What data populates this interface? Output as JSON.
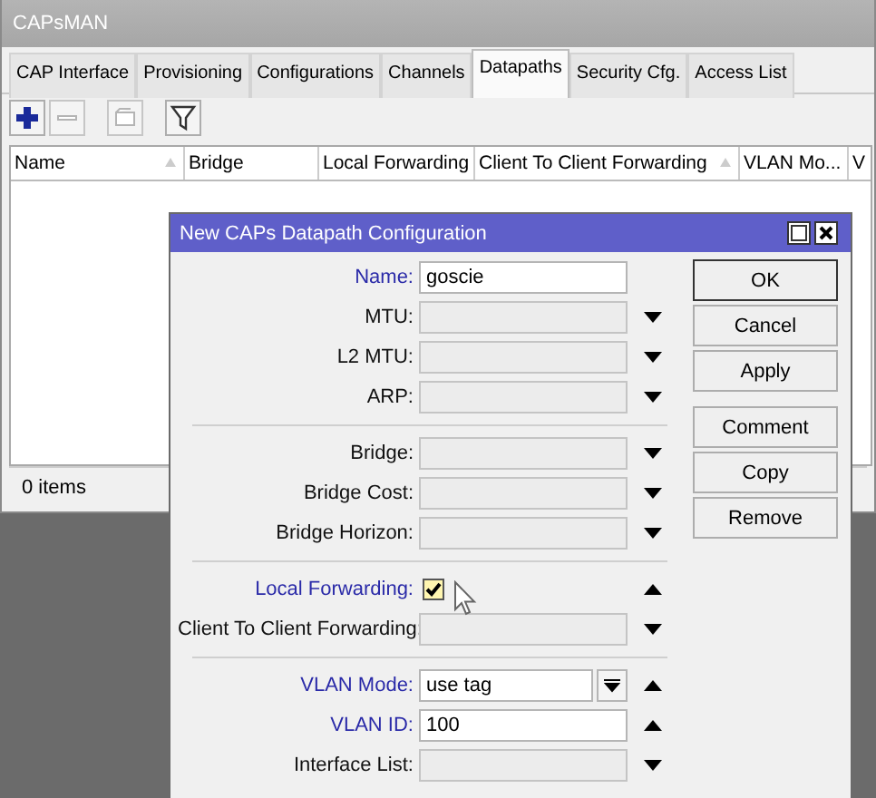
{
  "window": {
    "title": "CAPsMAN"
  },
  "tabs": [
    {
      "label": "CAP Interface",
      "selected": false
    },
    {
      "label": "Provisioning",
      "selected": false
    },
    {
      "label": "Configurations",
      "selected": false
    },
    {
      "label": "Channels",
      "selected": false
    },
    {
      "label": "Datapaths",
      "selected": true
    },
    {
      "label": "Security Cfg.",
      "selected": false
    },
    {
      "label": "Access List",
      "selected": false
    }
  ],
  "toolbar": [
    {
      "kind": "add",
      "disabled": false
    },
    {
      "kind": "remove",
      "disabled": true
    },
    {
      "kind": "comment",
      "disabled": true
    },
    {
      "kind": "filter",
      "disabled": false
    }
  ],
  "table": {
    "columns": [
      {
        "label": "Name",
        "sorted": true
      },
      {
        "label": "Bridge",
        "sorted": false
      },
      {
        "label": "Local Forwarding",
        "sorted": false
      },
      {
        "label": "Client To Client Forwarding",
        "sorted": true
      },
      {
        "label": "VLAN Mo...",
        "sorted": false
      },
      {
        "label": "V",
        "sorted": false
      }
    ]
  },
  "status_bar": "0 items",
  "dialog": {
    "title": "New CAPs Datapath Configuration",
    "groups": [
      [
        {
          "kind": "text",
          "label": "Name:",
          "highlighted": true,
          "value": "goscie"
        },
        {
          "kind": "combo",
          "label": "MTU:",
          "highlighted": false,
          "expanded": false
        },
        {
          "kind": "combo",
          "label": "L2 MTU:",
          "highlighted": false,
          "expanded": false
        },
        {
          "kind": "combo",
          "label": "ARP:",
          "highlighted": false,
          "expanded": false
        }
      ],
      [
        {
          "kind": "combo",
          "label": "Bridge:",
          "highlighted": false,
          "expanded": false
        },
        {
          "kind": "combo",
          "label": "Bridge Cost:",
          "highlighted": false,
          "expanded": false
        },
        {
          "kind": "combo",
          "label": "Bridge Horizon:",
          "highlighted": false,
          "expanded": false
        }
      ],
      [
        {
          "kind": "checkbox",
          "label": "Local Forwarding:",
          "highlighted": true,
          "checked": true,
          "expanded": true
        },
        {
          "kind": "combo",
          "label": "Client To Client Forwarding:",
          "highlighted": false,
          "expanded": false
        }
      ],
      [
        {
          "kind": "select",
          "label": "VLAN Mode:",
          "highlighted": true,
          "value": "use tag",
          "expanded": true
        },
        {
          "kind": "text",
          "label": "VLAN ID:",
          "highlighted": true,
          "value": "100",
          "expanded": true
        },
        {
          "kind": "combo",
          "label": "Interface List:",
          "highlighted": false,
          "expanded": false
        }
      ]
    ],
    "buttons": [
      [
        "OK",
        "Cancel",
        "Apply"
      ],
      [
        "Comment",
        "Copy",
        "Remove"
      ]
    ]
  }
}
